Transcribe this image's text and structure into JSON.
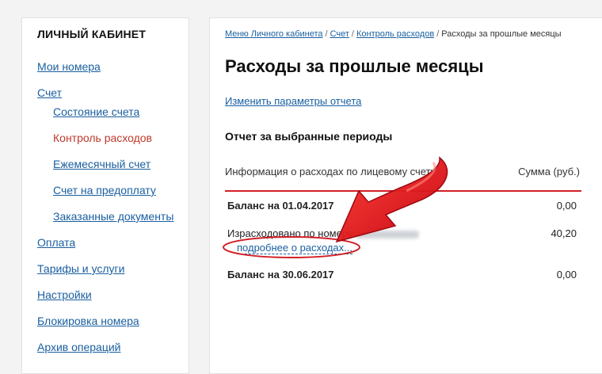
{
  "sidebar": {
    "title": "ЛИЧНЫЙ КАБИНЕТ",
    "items": [
      {
        "label": "Мои номера"
      },
      {
        "label": "Счет"
      },
      {
        "label": "Состояние счета"
      },
      {
        "label": "Контроль расходов"
      },
      {
        "label": "Ежемесячный счет"
      },
      {
        "label": "Счет на предоплату"
      },
      {
        "label": "Заказанные документы"
      },
      {
        "label": "Оплата"
      },
      {
        "label": "Тарифы и услуги"
      },
      {
        "label": "Настройки"
      },
      {
        "label": "Блокировка номера"
      },
      {
        "label": "Архив операций"
      }
    ]
  },
  "breadcrumb": {
    "items": [
      "Меню Личного кабинета",
      "Счет",
      "Контроль расходов"
    ],
    "current": "Расходы за прошлые месяцы",
    "separator": "/"
  },
  "page": {
    "title": "Расходы за прошлые месяцы",
    "params_link": "Изменить параметры отчета"
  },
  "report": {
    "title": "Отчет за выбранные периоды",
    "col_info": "Информация о расходах по лицевому счету",
    "col_sum": "Сумма (руб.)",
    "rows": [
      {
        "label": "Баланс на 01.04.2017",
        "value": "0,00"
      },
      {
        "label": "Израсходовано по номеру",
        "value": "40,20"
      },
      {
        "label": "Баланс на 30.06.2017",
        "value": "0,00"
      }
    ],
    "details_link": "подробнее о расходах..."
  },
  "colors": {
    "accent": "#d21f26",
    "link": "#1a5fa0",
    "active": "#c0392b"
  }
}
